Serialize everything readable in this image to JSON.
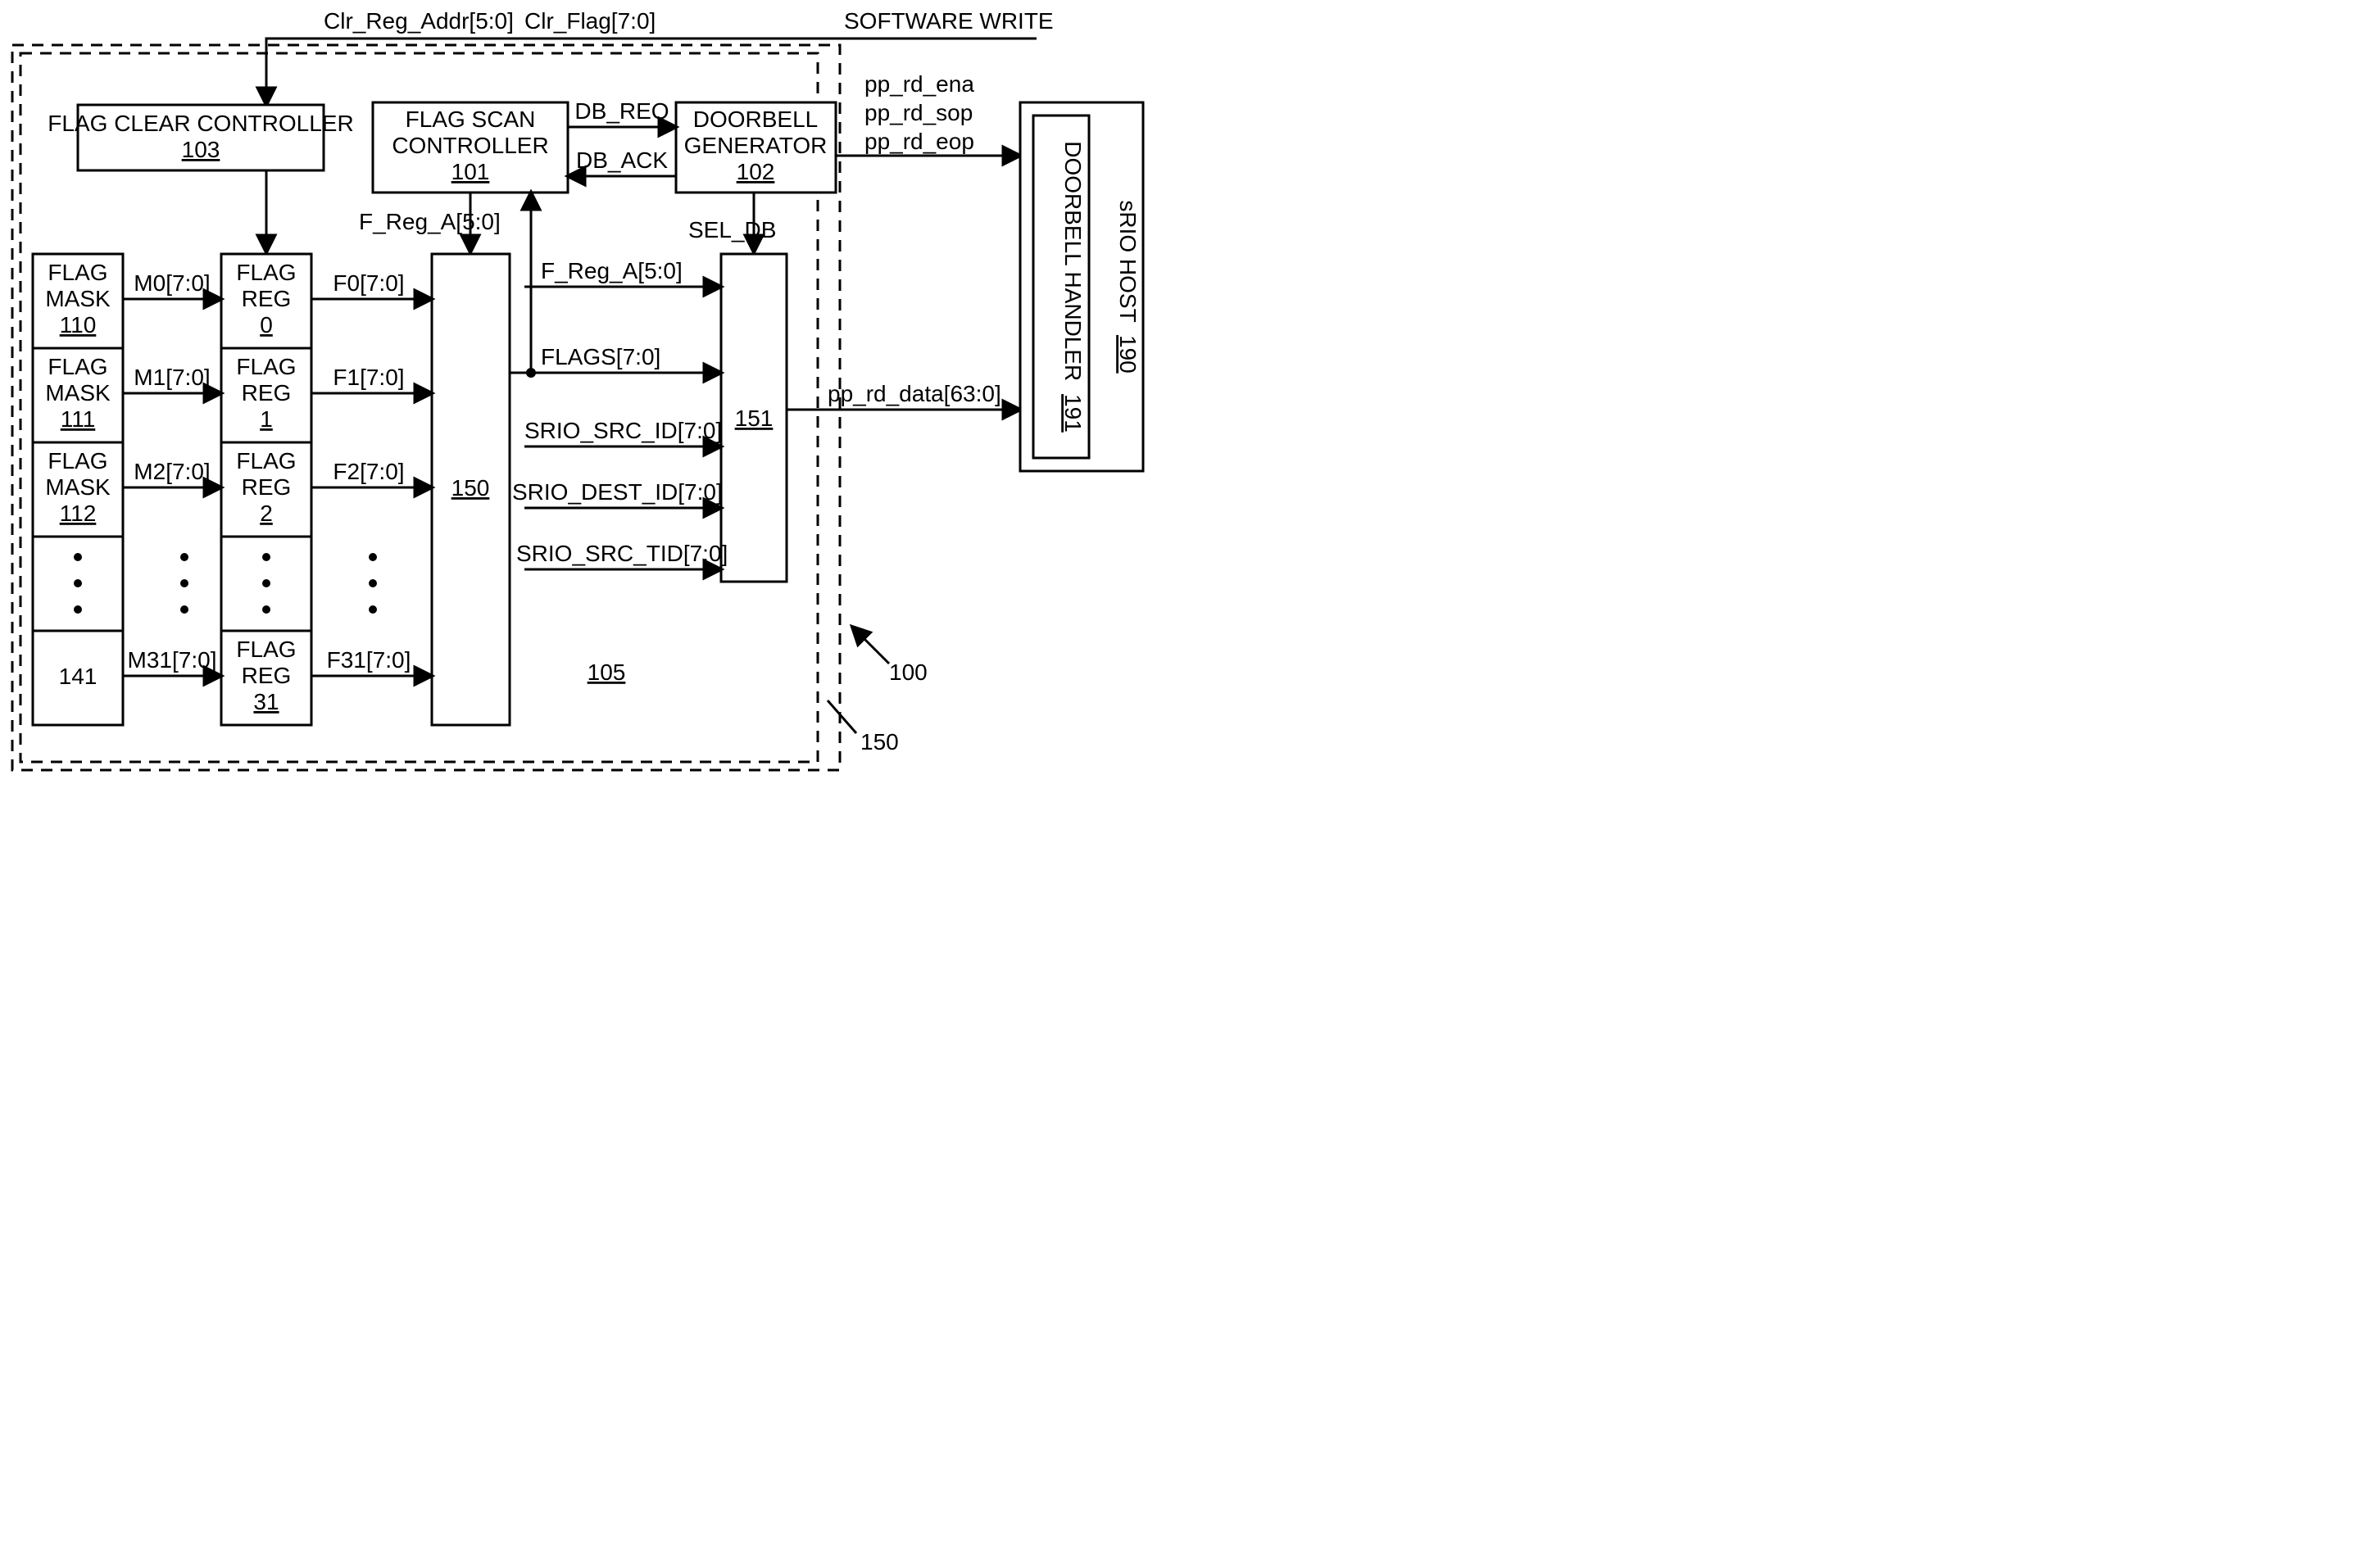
{
  "top_labels": {
    "clr_reg_addr": "Clr_Reg_Addr[5:0]",
    "clr_flag": "Clr_Flag[7:0]",
    "software_write": "SOFTWARE WRITE"
  },
  "blocks": {
    "flag_clear_controller_title": "FLAG CLEAR CONTROLLER",
    "flag_clear_controller_num": "103",
    "flag_scan_controller_title_l1": "FLAG SCAN",
    "flag_scan_controller_title_l2": "CONTROLLER",
    "flag_scan_controller_num": "101",
    "doorbell_gen_l1": "DOORBELL",
    "doorbell_gen_l2": "GENERATOR",
    "doorbell_gen_num": "102",
    "srio_host_l1": "sRIO HOST",
    "srio_host_num": "190",
    "doorbell_handler_l1": "DOORBELL HANDLER",
    "doorbell_handler_num": "191",
    "mux1_num": "150",
    "mux2_num": "151",
    "floating_num": "105"
  },
  "masks": [
    {
      "l1": "FLAG",
      "l2": "MASK",
      "num": "110"
    },
    {
      "l1": "FLAG",
      "l2": "MASK",
      "num": "111"
    },
    {
      "l1": "FLAG",
      "l2": "MASK",
      "num": "112"
    },
    {
      "l1": "",
      "l2": "",
      "num": "141"
    }
  ],
  "regs": [
    {
      "l1": "FLAG",
      "l2": "REG",
      "num": "0"
    },
    {
      "l1": "FLAG",
      "l2": "REG",
      "num": "1"
    },
    {
      "l1": "FLAG",
      "l2": "REG",
      "num": "2"
    },
    {
      "l1": "FLAG",
      "l2": "REG",
      "num": "31"
    }
  ],
  "m_signals": [
    "M0[7:0]",
    "M1[7:0]",
    "M2[7:0]",
    "M31[7:0]"
  ],
  "f_signals": [
    "F0[7:0]",
    "F1[7:0]",
    "F2[7:0]",
    "F31[7:0]"
  ],
  "signals": {
    "db_req": "DB_REQ",
    "db_ack": "DB_ACK",
    "f_reg_a_top": "F_Reg_A[5:0]",
    "sel_db": "SEL_DB",
    "f_reg_a_right": "F_Reg_A[5:0]",
    "flags": "FLAGS[7:0]",
    "srio_src_id": "SRIO_SRC_ID[7:0]",
    "srio_dest_id": "SRIO_DEST_ID[7:0]",
    "srio_src_tid": "SRIO_SRC_TID[7:0]",
    "pp_rd_ena": "pp_rd_ena",
    "pp_rd_sop": "pp_rd_sop",
    "pp_rd_eop": "pp_rd_eop",
    "pp_rd_data": "pp_rd_data[63:0]"
  },
  "annotations": {
    "n100": "100",
    "n150": "150"
  }
}
